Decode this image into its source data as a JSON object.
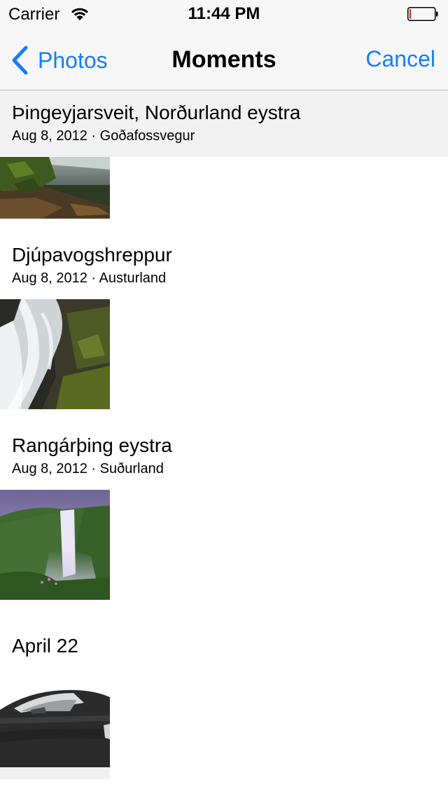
{
  "status_bar": {
    "carrier": "Carrier",
    "time": "11:44 PM",
    "battery_level": 0.05,
    "battery_color": "#e0251b"
  },
  "nav": {
    "back_label": "Photos",
    "title": "Moments",
    "cancel_label": "Cancel",
    "accent_color": "#157efb"
  },
  "sections": [
    {
      "title": "Þingeyjarsveit, Norðurland eystra",
      "subtitle": "Aug 8, 2012 · Goðafossvegur",
      "photos": 1
    },
    {
      "title": "Djúpavogshreppur",
      "subtitle": "Aug 8, 2012 · Austurland",
      "photos": 1
    },
    {
      "title": "Rangárþing eystra",
      "subtitle": "Aug 8, 2012 · Suðurland",
      "photos": 1
    },
    {
      "title": "April 22",
      "subtitle": "",
      "photos": 1
    }
  ]
}
